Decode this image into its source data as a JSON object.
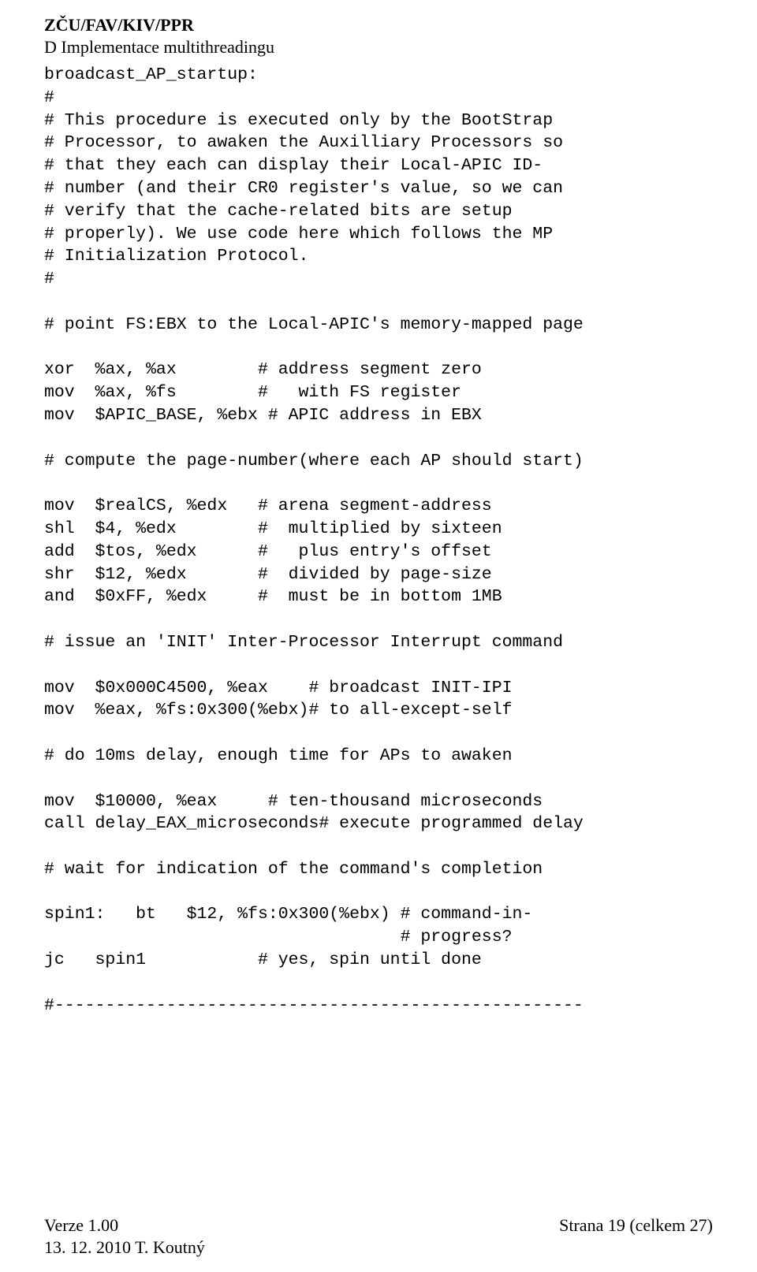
{
  "header": {
    "line1": "ZČU/FAV/KIV/PPR",
    "line2": "D Implementace multithreadingu"
  },
  "code": {
    "lines": [
      "broadcast_AP_startup:",
      "#",
      "# This procedure is executed only by the BootStrap",
      "# Processor, to awaken the Auxilliary Processors so",
      "# that they each can display their Local-APIC ID-",
      "# number (and their CR0 register's value, so we can",
      "# verify that the cache-related bits are setup ",
      "# properly). We use code here which follows the MP ",
      "# Initialization Protocol.",
      "#",
      "",
      "# point FS:EBX to the Local-APIC's memory-mapped page",
      "",
      "xor  %ax, %ax        # address segment zero",
      "mov  %ax, %fs        #   with FS register",
      "mov  $APIC_BASE, %ebx # APIC address in EBX",
      "",
      "# compute the page-number(where each AP should start)",
      "",
      "mov  $realCS, %edx   # arena segment-address ",
      "shl  $4, %edx        #  multiplied by sixteen",
      "add  $tos, %edx      #   plus entry's offset",
      "shr  $12, %edx       #  divided by page-size ",
      "and  $0xFF, %edx     #  must be in bottom 1MB",
      "",
      "# issue an 'INIT' Inter-Processor Interrupt command",
      "",
      "mov  $0x000C4500, %eax    # broadcast INIT-IPI",
      "mov  %eax, %fs:0x300(%ebx)# to all-except-self",
      "",
      "# do 10ms delay, enough time for APs to awaken",
      "",
      "mov  $10000, %eax     # ten-thousand microseconds",
      "call delay_EAX_microseconds# execute programmed delay",
      "",
      "# wait for indication of the command's completion",
      "",
      "spin1:   bt   $12, %fs:0x300(%ebx) # command-in-",
      "                                   # progress?",
      "jc   spin1           # yes, spin until done",
      "",
      "#----------------------------------------------------"
    ]
  },
  "footer": {
    "left_line1": "Verze 1.00",
    "left_line2": "13. 12. 2010 T. Koutný",
    "right": "Strana 19 (celkem 27)"
  }
}
